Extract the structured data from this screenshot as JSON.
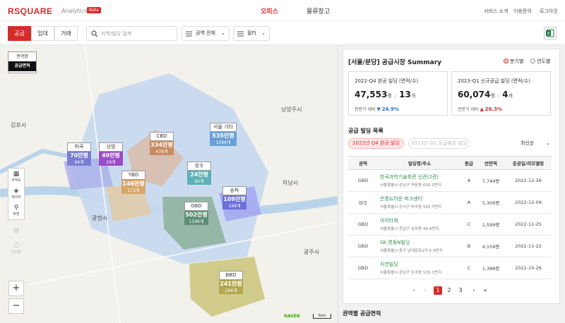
{
  "header": {
    "logo": "RSQUARE",
    "logo_sub": "Analytics",
    "beta": "Beta",
    "nav": [
      "오피스",
      "물류창고"
    ],
    "util": [
      "서비스 소개",
      "이용문의",
      "로그아웃"
    ]
  },
  "toolbar": {
    "tabs": [
      "공급",
      "임대",
      "거래"
    ],
    "search_placeholder": "지역/빌딩 검색",
    "region_filter": "권역 전체",
    "filter_label": "필터"
  },
  "map": {
    "legend_region": "권역명",
    "legend_supply": "공급면적",
    "side_buttons": [
      "지적도",
      "레이어",
      "주변",
      "",
      "다각형"
    ],
    "zoom_in": "+",
    "zoom_out": "−",
    "place_labels": [
      "김포시",
      "남양주시",
      "광명시",
      "광주시",
      "하남시"
    ],
    "scale": "5km",
    "markers": [
      {
        "name": "마곡",
        "value": "70만평",
        "count": "94개",
        "color": "#7a7fd1"
      },
      {
        "name": "상암",
        "value": "49만평",
        "count": "29개",
        "color": "#9b4cc9"
      },
      {
        "name": "CBD",
        "value": "334만평",
        "count": "478개",
        "color": "#c98b63"
      },
      {
        "name": "서울 기타",
        "value": "535만평",
        "count": "1294개",
        "color": "#6ba0d6"
      },
      {
        "name": "YBD",
        "value": "146만평",
        "count": "173개",
        "color": "#d6a76b"
      },
      {
        "name": "성수",
        "value": "24만평",
        "count": "62개",
        "color": "#5fb0b6"
      },
      {
        "name": "송파",
        "value": "109만평",
        "count": "169개",
        "color": "#6d70d8"
      },
      {
        "name": "GBD",
        "value": "502만평",
        "count": "1199개",
        "color": "#5e8f76"
      },
      {
        "name": "BBD",
        "value": "241만평",
        "count": "266개",
        "color": "#b3a84f"
      }
    ]
  },
  "summary": {
    "title": "[서울/분당] 공급시장 Summary",
    "radio": [
      "분기별",
      "연도별"
    ],
    "stats": [
      {
        "label": "2022-Q4 완공 빌딩 (면적/수)",
        "area": "47,553",
        "area_unit": "평",
        "count": "13",
        "count_unit": "개",
        "change_label": "전분기 대비",
        "change_arrow": "▼",
        "change": "24.9%",
        "change_color": "#2b6fd6"
      },
      {
        "label": "2023-Q1 신규공급 빌딩 (면적/수)",
        "area": "60,074",
        "area_unit": "평",
        "count": "4",
        "count_unit": "개",
        "change_label": "전분기 대비",
        "change_arrow": "▲",
        "change": "26.3%",
        "change_color": "#d62b2b"
      }
    ],
    "list_title": "공급 빌딩 목록",
    "pills": [
      "2022년 Q4 완공 빌딩",
      "2023년 Q1 공급예정 빌딩"
    ],
    "sort": "최신순",
    "columns": [
      "권역",
      "빌딩명/주소",
      "등급",
      "연면적",
      "준공일/리모델링"
    ],
    "rows": [
      {
        "region": "GBD",
        "name": "한국과학기술회관 신관(2관)",
        "addr": "서울특별시 강남구 역삼동 635-2번지",
        "grade": "A",
        "area": "7,744평",
        "date": "2022-12-26"
      },
      {
        "region": "마곡",
        "name": "은평뉴타운 퍼크센터",
        "addr": "서울특별시 강서구 마곡동 555-7번지",
        "grade": "A",
        "area": "5,306평",
        "date": "2022-12-09"
      },
      {
        "region": "GBD",
        "name": "아이타워",
        "addr": "서울특별시 강남구 삼성동 49-9번지",
        "grade": "C",
        "area": "1,599평",
        "date": "2022-11-25"
      },
      {
        "region": "GBD",
        "name": "SK 명동N빌딩",
        "addr": "서울특별시 중구 남대문로2가 5-3번지",
        "grade": "B",
        "area": "4,159평",
        "date": "2022-11-22"
      },
      {
        "region": "GBD",
        "name": "지연빌딩",
        "addr": "서울특별시 강남구 도곡동 515-1번지",
        "grade": "C",
        "area": "1,388평",
        "date": "2022-10-26"
      }
    ],
    "pages": [
      "1",
      "2",
      "3"
    ],
    "section2": "권역별 공급면적"
  }
}
